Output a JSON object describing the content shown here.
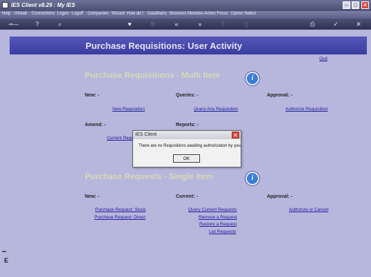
{
  "window": {
    "title": "IES Client v8.29 : My IES"
  },
  "menu": [
    "Help",
    "Infolab",
    "Connections",
    "Logon",
    "Logoff",
    "Companies",
    "Wizard",
    "How do I",
    "DataMarts",
    "Business Modules",
    "Action Focus",
    "Option Select"
  ],
  "page": {
    "title": "Purchase Requisitions: User Activity",
    "quit": "Quit",
    "multi": {
      "heading": "Purchase Requisitions - Multi Item",
      "new_label": "New: -",
      "queries_label": "Queries: -",
      "approval_label": "Approval: -",
      "new_requisition": "New Requisition",
      "query_any": "Query Any Requisition",
      "authorize": "Authorize Requisition",
      "amend_label": "Amend: -",
      "reports_label": "Reports: -",
      "current_req": "Current Requ"
    },
    "single": {
      "heading": "Purchase Requests - Single Item",
      "new_label": "New: -",
      "current_label": "Current: -",
      "approval_label": "Approval: -",
      "stock": "Purchase Request: Stock",
      "direct": "Purchase Request: Direct",
      "query_current": "Query Current Requests",
      "remove": "Remove a Request",
      "restore": "Restore a Request",
      "list": "List Requests",
      "authorize_cancel": "Authorize or Cancel"
    }
  },
  "dialog": {
    "title": "IES Client",
    "message": "There are no Requisitions awaiting authorization by you.",
    "ok": "OK"
  },
  "colors": {
    "header": "#4548ab",
    "background": "#b7b6dd",
    "section": "#d9d9b4",
    "link": "#1a1a9a"
  }
}
